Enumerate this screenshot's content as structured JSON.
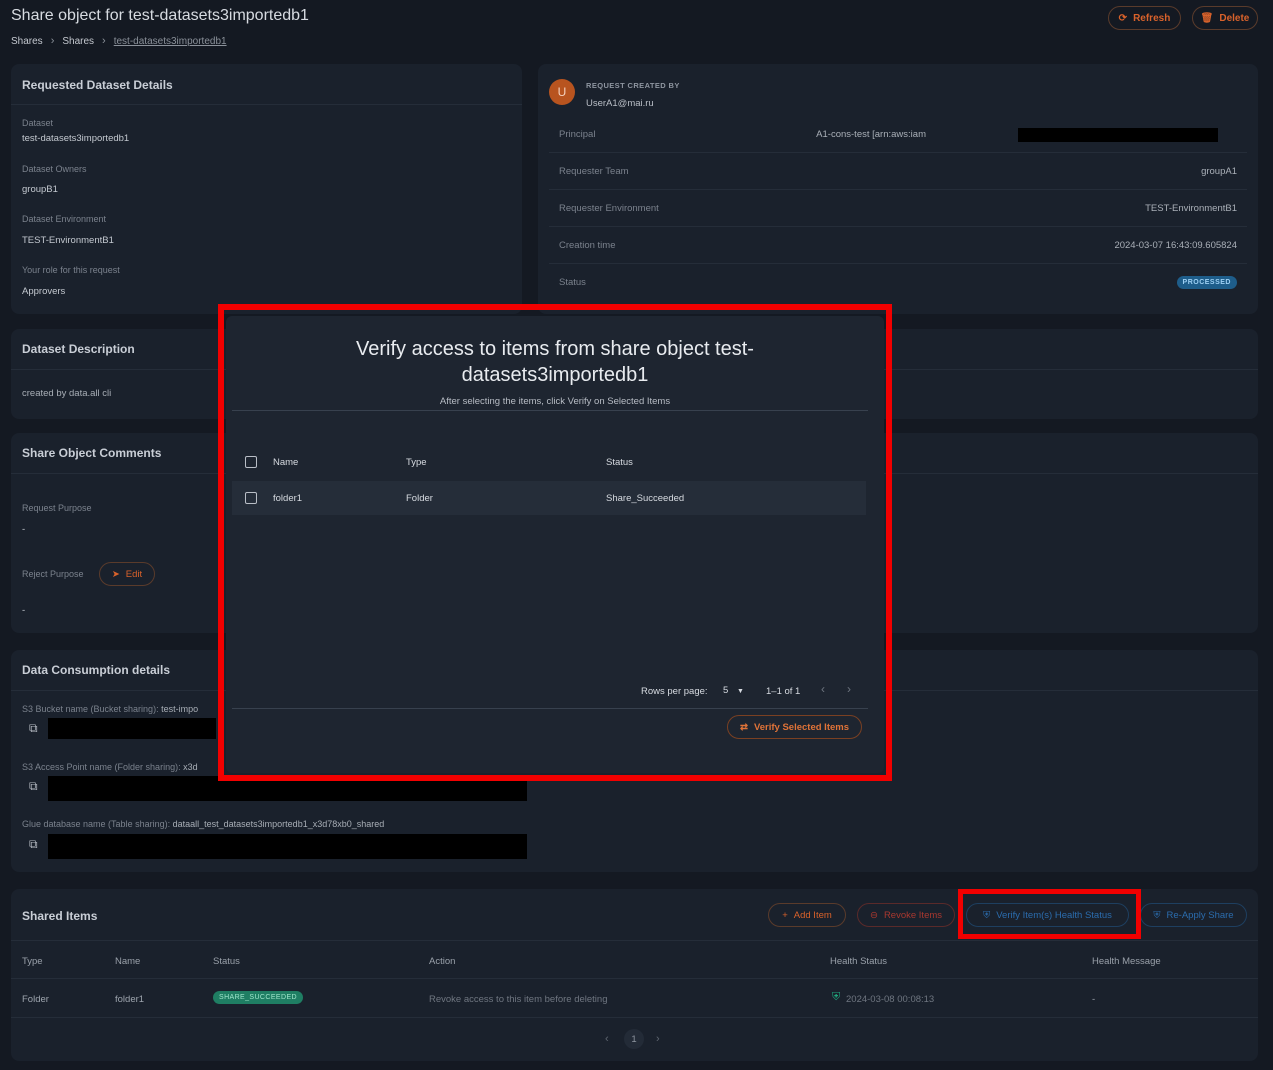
{
  "header": {
    "title": "Share object for test-datasets3importedb1",
    "breadcrumb": [
      "Shares",
      "Shares",
      "test-datasets3importedb1"
    ],
    "refresh_label": "Refresh",
    "delete_label": "Delete"
  },
  "requested_dataset": {
    "title": "Requested Dataset Details",
    "fields": [
      {
        "label": "Dataset",
        "value": "test-datasets3importedb1"
      },
      {
        "label": "Dataset Owners",
        "value": "groupB1"
      },
      {
        "label": "Dataset Environment",
        "value": "TEST-EnvironmentB1"
      },
      {
        "label": "Your role for this request",
        "value": "Approvers"
      }
    ]
  },
  "request": {
    "avatar_letter": "U",
    "created_by_label": "REQUEST CREATED BY",
    "created_by": "UserA1@mai.ru",
    "rows": [
      {
        "label": "Principal",
        "value": "A1-cons-test [arn:aws:iam"
      },
      {
        "label": "Requester Team",
        "value": "groupA1"
      },
      {
        "label": "Requester Environment",
        "value": "TEST-EnvironmentB1"
      },
      {
        "label": "Creation time",
        "value": "2024-03-07 16:43:09.605824"
      },
      {
        "label": "Status",
        "value": "PROCESSED"
      }
    ]
  },
  "description": {
    "title": "Dataset Description",
    "text": "created by data.all cli"
  },
  "comments": {
    "title": "Share Object Comments",
    "request_purpose_label": "Request Purpose",
    "request_purpose": "-",
    "reject_purpose_label": "Reject Purpose",
    "edit_label": "Edit",
    "reject_purpose": "-"
  },
  "consumption": {
    "title": "Data Consumption details",
    "s3_bucket_label": "S3 Bucket name (Bucket sharing):",
    "s3_bucket_value": "test-impo",
    "access_point_label": "S3 Access Point name (Folder sharing):",
    "access_point_value": "x3d",
    "glue_label": "Glue database name (Table sharing):",
    "glue_value": "dataall_test_datasets3importedb1_x3d78xb0_shared"
  },
  "shared_items": {
    "title": "Shared Items",
    "add_label": "Add Item",
    "revoke_label": "Revoke Items",
    "verify_label": "Verify Item(s) Health Status",
    "reapply_label": "Re-Apply Share",
    "columns": [
      "Type",
      "Name",
      "Status",
      "Action",
      "Health Status",
      "Health Message"
    ],
    "rows": [
      {
        "type": "Folder",
        "name": "folder1",
        "status": "SHARE_SUCCEEDED",
        "action": "Revoke access to this item before deleting",
        "health_status": "2024-03-08 00:08:13",
        "health_message": "-"
      }
    ],
    "page": "1"
  },
  "modal": {
    "title": "Verify access to items from share object test-datasets3importedb1",
    "subtitle": "After selecting the items, click Verify on Selected Items",
    "columns": [
      "Name",
      "Type",
      "Status"
    ],
    "rows": [
      {
        "name": "folder1",
        "type": "Folder",
        "status": "Share_Succeeded"
      }
    ],
    "rows_per_page_label": "Rows per page:",
    "rows_per_page": "5",
    "range": "1–1 of 1",
    "verify_button": "Verify Selected Items"
  },
  "colors": {
    "accent": "#d9622b",
    "highlight": "#f20000",
    "success": "#1f8f6f",
    "info": "#1e5d8a"
  }
}
